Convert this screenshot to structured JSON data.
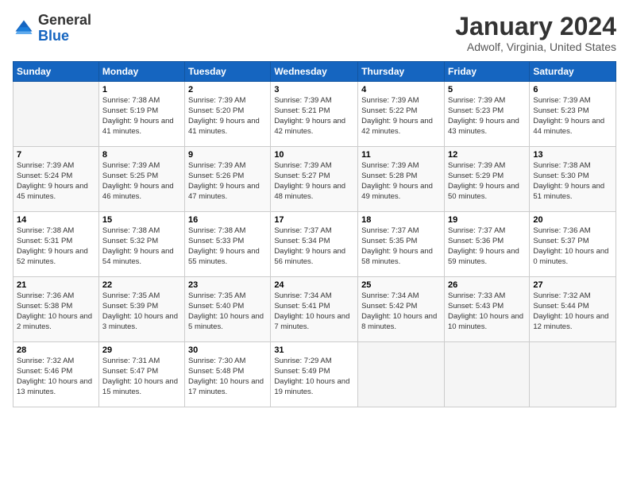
{
  "header": {
    "logo_general": "General",
    "logo_blue": "Blue",
    "month_title": "January 2024",
    "subtitle": "Adwolf, Virginia, United States"
  },
  "weekdays": [
    "Sunday",
    "Monday",
    "Tuesday",
    "Wednesday",
    "Thursday",
    "Friday",
    "Saturday"
  ],
  "weeks": [
    [
      {
        "day": "",
        "sunrise": "",
        "sunset": "",
        "daylight": ""
      },
      {
        "day": "1",
        "sunrise": "Sunrise: 7:38 AM",
        "sunset": "Sunset: 5:19 PM",
        "daylight": "Daylight: 9 hours and 41 minutes."
      },
      {
        "day": "2",
        "sunrise": "Sunrise: 7:39 AM",
        "sunset": "Sunset: 5:20 PM",
        "daylight": "Daylight: 9 hours and 41 minutes."
      },
      {
        "day": "3",
        "sunrise": "Sunrise: 7:39 AM",
        "sunset": "Sunset: 5:21 PM",
        "daylight": "Daylight: 9 hours and 42 minutes."
      },
      {
        "day": "4",
        "sunrise": "Sunrise: 7:39 AM",
        "sunset": "Sunset: 5:22 PM",
        "daylight": "Daylight: 9 hours and 42 minutes."
      },
      {
        "day": "5",
        "sunrise": "Sunrise: 7:39 AM",
        "sunset": "Sunset: 5:23 PM",
        "daylight": "Daylight: 9 hours and 43 minutes."
      },
      {
        "day": "6",
        "sunrise": "Sunrise: 7:39 AM",
        "sunset": "Sunset: 5:23 PM",
        "daylight": "Daylight: 9 hours and 44 minutes."
      }
    ],
    [
      {
        "day": "7",
        "sunrise": "Sunrise: 7:39 AM",
        "sunset": "Sunset: 5:24 PM",
        "daylight": "Daylight: 9 hours and 45 minutes."
      },
      {
        "day": "8",
        "sunrise": "Sunrise: 7:39 AM",
        "sunset": "Sunset: 5:25 PM",
        "daylight": "Daylight: 9 hours and 46 minutes."
      },
      {
        "day": "9",
        "sunrise": "Sunrise: 7:39 AM",
        "sunset": "Sunset: 5:26 PM",
        "daylight": "Daylight: 9 hours and 47 minutes."
      },
      {
        "day": "10",
        "sunrise": "Sunrise: 7:39 AM",
        "sunset": "Sunset: 5:27 PM",
        "daylight": "Daylight: 9 hours and 48 minutes."
      },
      {
        "day": "11",
        "sunrise": "Sunrise: 7:39 AM",
        "sunset": "Sunset: 5:28 PM",
        "daylight": "Daylight: 9 hours and 49 minutes."
      },
      {
        "day": "12",
        "sunrise": "Sunrise: 7:39 AM",
        "sunset": "Sunset: 5:29 PM",
        "daylight": "Daylight: 9 hours and 50 minutes."
      },
      {
        "day": "13",
        "sunrise": "Sunrise: 7:38 AM",
        "sunset": "Sunset: 5:30 PM",
        "daylight": "Daylight: 9 hours and 51 minutes."
      }
    ],
    [
      {
        "day": "14",
        "sunrise": "Sunrise: 7:38 AM",
        "sunset": "Sunset: 5:31 PM",
        "daylight": "Daylight: 9 hours and 52 minutes."
      },
      {
        "day": "15",
        "sunrise": "Sunrise: 7:38 AM",
        "sunset": "Sunset: 5:32 PM",
        "daylight": "Daylight: 9 hours and 54 minutes."
      },
      {
        "day": "16",
        "sunrise": "Sunrise: 7:38 AM",
        "sunset": "Sunset: 5:33 PM",
        "daylight": "Daylight: 9 hours and 55 minutes."
      },
      {
        "day": "17",
        "sunrise": "Sunrise: 7:37 AM",
        "sunset": "Sunset: 5:34 PM",
        "daylight": "Daylight: 9 hours and 56 minutes."
      },
      {
        "day": "18",
        "sunrise": "Sunrise: 7:37 AM",
        "sunset": "Sunset: 5:35 PM",
        "daylight": "Daylight: 9 hours and 58 minutes."
      },
      {
        "day": "19",
        "sunrise": "Sunrise: 7:37 AM",
        "sunset": "Sunset: 5:36 PM",
        "daylight": "Daylight: 9 hours and 59 minutes."
      },
      {
        "day": "20",
        "sunrise": "Sunrise: 7:36 AM",
        "sunset": "Sunset: 5:37 PM",
        "daylight": "Daylight: 10 hours and 0 minutes."
      }
    ],
    [
      {
        "day": "21",
        "sunrise": "Sunrise: 7:36 AM",
        "sunset": "Sunset: 5:38 PM",
        "daylight": "Daylight: 10 hours and 2 minutes."
      },
      {
        "day": "22",
        "sunrise": "Sunrise: 7:35 AM",
        "sunset": "Sunset: 5:39 PM",
        "daylight": "Daylight: 10 hours and 3 minutes."
      },
      {
        "day": "23",
        "sunrise": "Sunrise: 7:35 AM",
        "sunset": "Sunset: 5:40 PM",
        "daylight": "Daylight: 10 hours and 5 minutes."
      },
      {
        "day": "24",
        "sunrise": "Sunrise: 7:34 AM",
        "sunset": "Sunset: 5:41 PM",
        "daylight": "Daylight: 10 hours and 7 minutes."
      },
      {
        "day": "25",
        "sunrise": "Sunrise: 7:34 AM",
        "sunset": "Sunset: 5:42 PM",
        "daylight": "Daylight: 10 hours and 8 minutes."
      },
      {
        "day": "26",
        "sunrise": "Sunrise: 7:33 AM",
        "sunset": "Sunset: 5:43 PM",
        "daylight": "Daylight: 10 hours and 10 minutes."
      },
      {
        "day": "27",
        "sunrise": "Sunrise: 7:32 AM",
        "sunset": "Sunset: 5:44 PM",
        "daylight": "Daylight: 10 hours and 12 minutes."
      }
    ],
    [
      {
        "day": "28",
        "sunrise": "Sunrise: 7:32 AM",
        "sunset": "Sunset: 5:46 PM",
        "daylight": "Daylight: 10 hours and 13 minutes."
      },
      {
        "day": "29",
        "sunrise": "Sunrise: 7:31 AM",
        "sunset": "Sunset: 5:47 PM",
        "daylight": "Daylight: 10 hours and 15 minutes."
      },
      {
        "day": "30",
        "sunrise": "Sunrise: 7:30 AM",
        "sunset": "Sunset: 5:48 PM",
        "daylight": "Daylight: 10 hours and 17 minutes."
      },
      {
        "day": "31",
        "sunrise": "Sunrise: 7:29 AM",
        "sunset": "Sunset: 5:49 PM",
        "daylight": "Daylight: 10 hours and 19 minutes."
      },
      {
        "day": "",
        "sunrise": "",
        "sunset": "",
        "daylight": ""
      },
      {
        "day": "",
        "sunrise": "",
        "sunset": "",
        "daylight": ""
      },
      {
        "day": "",
        "sunrise": "",
        "sunset": "",
        "daylight": ""
      }
    ]
  ]
}
